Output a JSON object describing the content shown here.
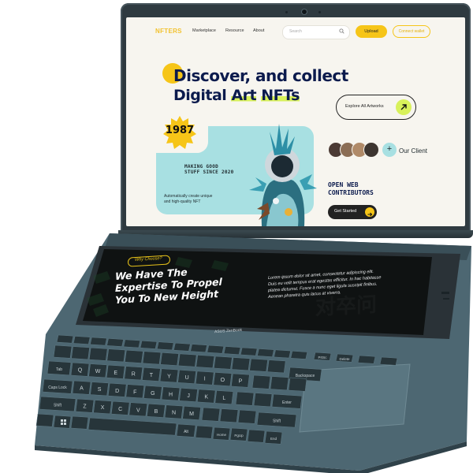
{
  "website": {
    "logo": "NFTERS",
    "nav_links": [
      "Marketplace",
      "Resource",
      "About"
    ],
    "search_placeholder": "Search",
    "upload_label": "Upload",
    "connect_wallet_label": "Connect wallet",
    "hero_line1": "Discover, and collect",
    "hero_line2_a": "Digital",
    "hero_line2_b": "Art",
    "hero_line2_c": "NFTs",
    "explore_label": "Explore All Artworks",
    "year_badge": "1987",
    "making_line1": "MAKING GOOD",
    "making_line2": "STUFF SINCE 2020",
    "auto_line1": "Automatically create unique",
    "auto_line2": "and high-quality NFT",
    "our_client_label": "Our Client",
    "plus_label": "+",
    "open_web_line1": "OPEN WEB",
    "open_web_line2": "CONTRIBUTORS",
    "get_started_label": "Get Started"
  },
  "screenpad": {
    "why_choose": "Why Choose?",
    "headline_line1": "We Have The",
    "headline_line2": "Expertise To Propel",
    "headline_line3": "You To New Height",
    "lorem_line1": "Lorem ipsum dolor sit amet, consectetur adipiscing elit.",
    "lorem_line2": "Duis eu velit tempus erat egestas efficitur. In hac habitasse",
    "lorem_line3": "platea dictumst. Fusce a nunc eget ligula suscipit finibus.",
    "lorem_line4": "Aenean pharetra quis lacus at viverra."
  },
  "device": {
    "brand": "ASUS ZenBook"
  },
  "keyboard": {
    "row1": [
      "Q",
      "W",
      "E",
      "R",
      "T",
      "Y",
      "U",
      "I",
      "O",
      "P"
    ],
    "row2": [
      "A",
      "S",
      "D",
      "F",
      "G",
      "H",
      "J",
      "K",
      "L"
    ],
    "row3": [
      "Z",
      "X",
      "C",
      "V",
      "B",
      "N",
      "M"
    ],
    "labels": {
      "caps": "Caps Lock",
      "tab": "Tab",
      "shift": "Shift",
      "shift_r": "Shift",
      "enter": "Enter",
      "backspace": "Backspace",
      "delete": "Delete",
      "prtsc": "PrtSc",
      "alt": "Alt",
      "home": "Home",
      "pgup": "PgUp",
      "end": "End"
    }
  },
  "colors": {
    "accent_yellow": "#f6c518",
    "lime": "#d8f15b",
    "navy": "#0c1b4d",
    "teal": "#a8e0e2",
    "body": "#4c6570"
  }
}
